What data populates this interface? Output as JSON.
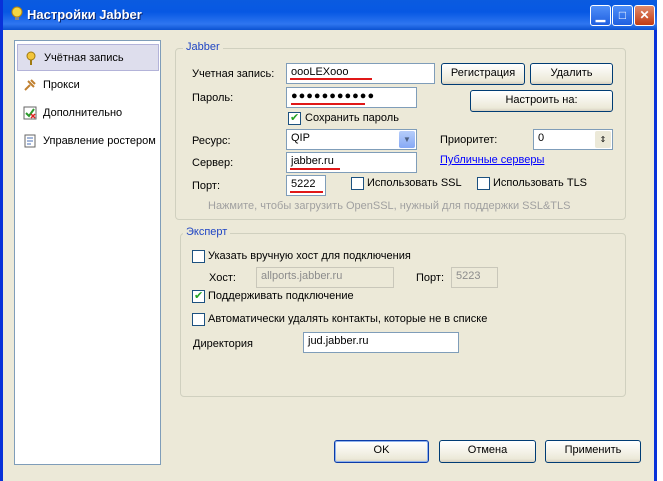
{
  "window": {
    "title": "Настройки Jabber"
  },
  "sidebar": {
    "items": [
      {
        "label": "Учётная запись",
        "icon": "user-key-icon",
        "selected": true
      },
      {
        "label": "Прокси",
        "icon": "plug-icon",
        "selected": false
      },
      {
        "label": "Дополнительно",
        "icon": "checklist-icon",
        "selected": false
      },
      {
        "label": "Управление ростером",
        "icon": "document-icon",
        "selected": false
      }
    ]
  },
  "jabber": {
    "legend": "Jabber",
    "account_label": "Учетная запись:",
    "account_value": "oooLEXooo",
    "password_label": "Пароль:",
    "password_value": "●●●●●●●●●●●",
    "register_button": "Регистрация",
    "delete_button": "Удалить",
    "configure_button": "Настроить на:",
    "save_password_label": "Сохранить пароль",
    "save_password_checked": true,
    "resource_label": "Ресурс:",
    "resource_value": "QIP",
    "priority_label": "Приоритет:",
    "priority_value": "0",
    "server_label": "Сервер:",
    "server_value": "jabber.ru",
    "public_servers_link": "Публичные серверы",
    "port_label": "Порт:",
    "port_value": "5222",
    "use_ssl_label": "Использовать SSL",
    "use_ssl_checked": false,
    "use_tls_label": "Использовать TLS",
    "use_tls_checked": false,
    "openssl_hint": "Нажмите, чтобы загрузить OpenSSL, нужный для поддержки SSL&TLS"
  },
  "expert": {
    "legend": "Эксперт",
    "manual_host_label": "Указать вручную хост для подключения",
    "manual_host_checked": false,
    "host_label": "Хост:",
    "host_value": "allports.jabber.ru",
    "port_label": "Порт:",
    "port_value": "5223",
    "keepalive_label": "Поддерживать подключение",
    "keepalive_checked": true,
    "autodelete_label": "Автоматически удалять контакты, которые не в списке",
    "autodelete_checked": false,
    "directory_label": "Директория",
    "directory_value": "jud.jabber.ru"
  },
  "footer": {
    "ok_button": "OK",
    "cancel_button": "Отмена",
    "apply_button": "Применить"
  },
  "colors": {
    "titlebar": "#0758e3",
    "annotation_underline": "#e01818",
    "window_bg": "#ece9d8"
  }
}
